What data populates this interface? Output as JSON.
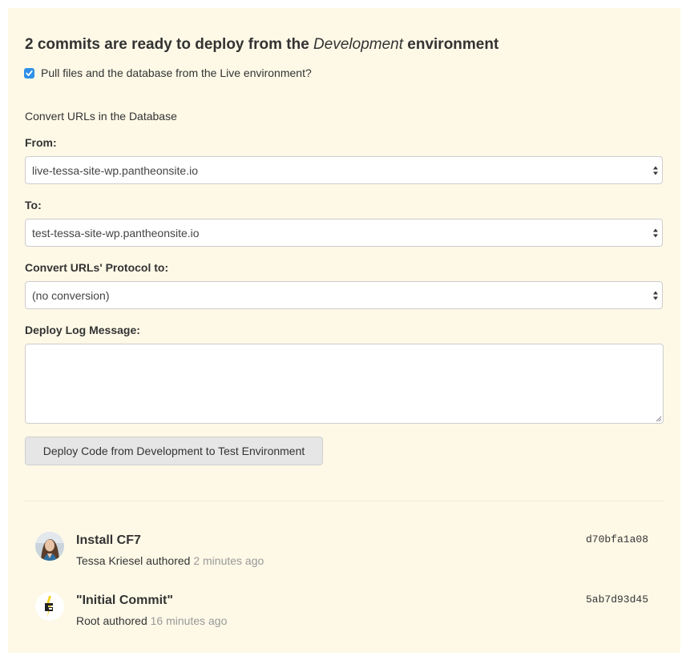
{
  "heading": {
    "prefix": "2 commits are ready to deploy from the ",
    "env": "Development",
    "suffix": " environment"
  },
  "pull_checkbox": {
    "label": "Pull files and the database from the Live environment?",
    "checked": true
  },
  "convert_section": {
    "title": "Convert URLs in the Database"
  },
  "from_field": {
    "label": "From:",
    "value": "live-tessa-site-wp.pantheonsite.io"
  },
  "to_field": {
    "label": "To:",
    "value": "test-tessa-site-wp.pantheonsite.io"
  },
  "protocol_field": {
    "label": "Convert URLs' Protocol to:",
    "value": "(no conversion)"
  },
  "log_field": {
    "label": "Deploy Log Message:",
    "value": ""
  },
  "deploy_button": {
    "label": "Deploy Code from Development to Test Environment"
  },
  "commits": [
    {
      "title": "Install CF7",
      "author": "Tessa Kriesel",
      "action": " authored ",
      "time": "2 minutes ago",
      "hash": "d70bfa1a08",
      "avatar": "user-photo"
    },
    {
      "title": "\"Initial Commit\"",
      "author": "Root",
      "action": " authored ",
      "time": "16 minutes ago",
      "hash": "5ab7d93d45",
      "avatar": "pantheon-logo"
    }
  ],
  "colors": {
    "panel_bg": "#fef9e7",
    "checkbox": "#2f8fe8",
    "muted_text": "#999999",
    "button_bg": "#e6e6e6"
  }
}
